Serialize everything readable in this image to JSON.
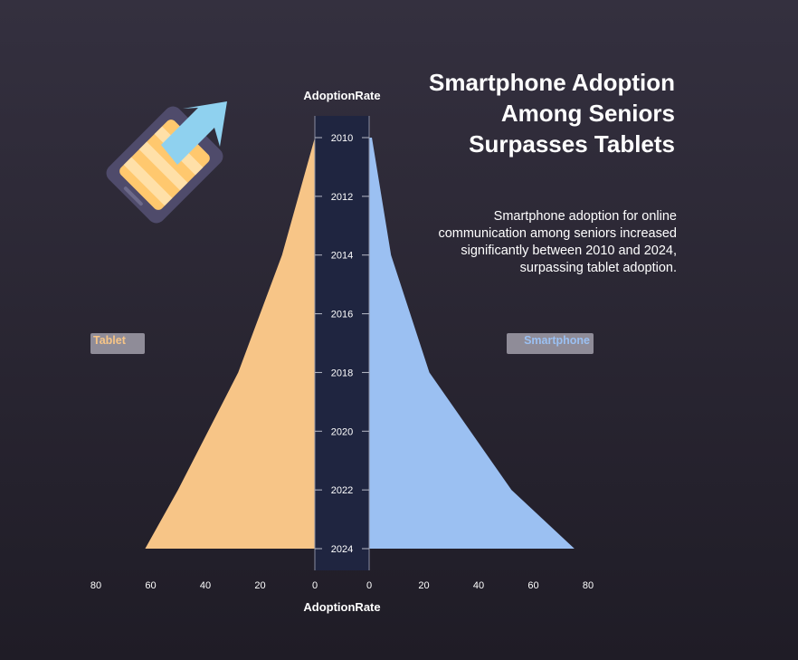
{
  "title": "Smartphone Adoption Among Seniors Surpasses Tablets",
  "subtitle": "Smartphone adoption for online communication among seniors increased significantly between 2010 and 2024, surpassing tablet adoption.",
  "icons": [
    "tablet-icon",
    "upward-arrow-icon"
  ],
  "colors": {
    "tablet": "#f7c587",
    "smartphone": "#9bc0f2",
    "center_band": "#1f2540",
    "legend_badge": "#8f8c98",
    "icon_frame": "#4f4b6b",
    "icon_screen": "#ffc86e",
    "arrow": "#8fd1ef"
  },
  "chart_data": {
    "type": "area",
    "layout": "mirrored butterfly (pyramid)",
    "title": "Smartphone Adoption Among Seniors Surpasses Tablets",
    "axis_title_top": "AdoptionRate",
    "axis_title_bottom": "AdoptionRate",
    "x": [
      2010,
      2014,
      2018,
      2022,
      2024
    ],
    "y_ticks": [
      "2010",
      "2012",
      "2014",
      "2016",
      "2018",
      "2020",
      "2022",
      "2024"
    ],
    "xlim": [
      0,
      80
    ],
    "x_ticks_left": [
      "80",
      "60",
      "40",
      "20",
      "0"
    ],
    "x_ticks_right": [
      "0",
      "20",
      "40",
      "60",
      "80"
    ],
    "series": [
      {
        "name": "Tablet",
        "side": "left",
        "values": [
          0,
          12,
          28,
          50,
          62
        ]
      },
      {
        "name": "Smartphone",
        "side": "right",
        "values": [
          1,
          8,
          22,
          52,
          75
        ]
      }
    ],
    "grid": false,
    "legend": "left and right labels at mid height"
  }
}
